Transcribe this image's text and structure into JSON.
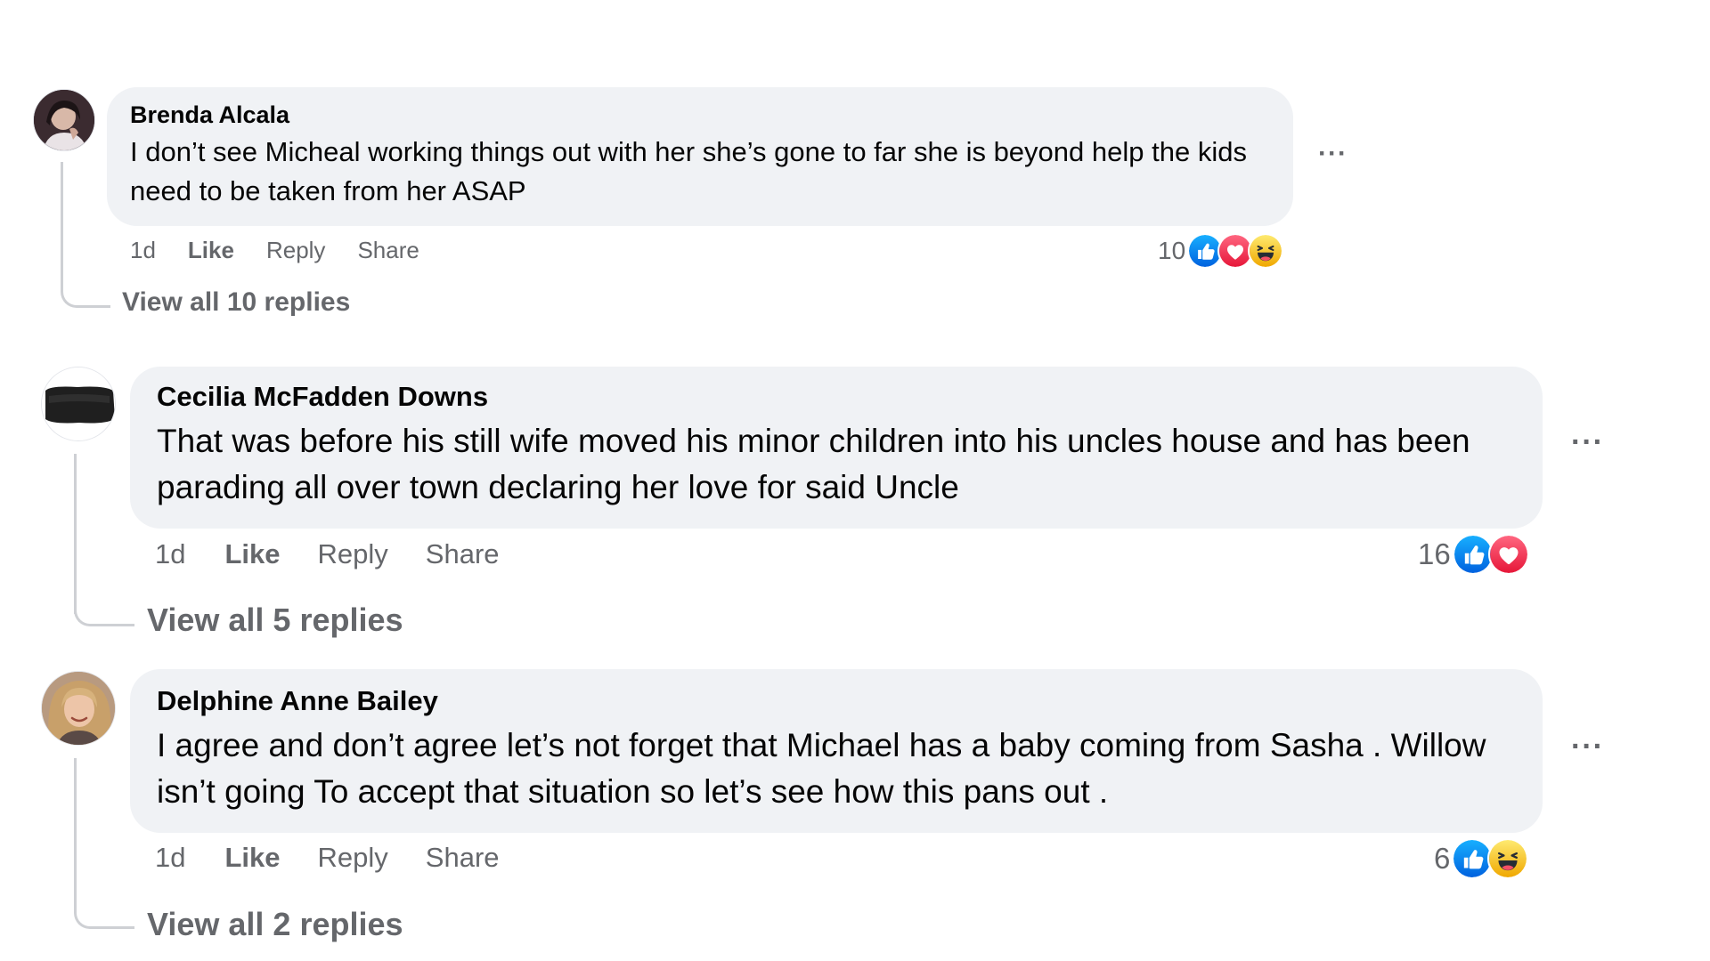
{
  "comments": [
    {
      "author": "Brenda Alcala",
      "text": "I don’t see Micheal working things out with her she’s gone to far she is beyond help the kids need to be taken from her ASAP",
      "time": "1d",
      "like_label": "Like",
      "reply_label": "Reply",
      "share_label": "Share",
      "reaction_count": "10",
      "reactions": [
        "like-icon",
        "love-icon",
        "haha-icon"
      ],
      "view_replies": "View all 10 replies",
      "more_label": "···"
    },
    {
      "author": "Cecilia McFadden Downs",
      "text": "That was before his still wife moved his minor children into his uncles house and has been parading all over town declaring her love for said Uncle",
      "time": "1d",
      "like_label": "Like",
      "reply_label": "Reply",
      "share_label": "Share",
      "reaction_count": "16",
      "reactions": [
        "like-icon",
        "love-icon"
      ],
      "view_replies": "View all 5 replies",
      "more_label": "···"
    },
    {
      "author": "Delphine Anne Bailey",
      "text": "I agree and don’t agree let’s not forget that Michael has a baby coming from Sasha . Willow isn’t going To accept that situation so let’s see how this pans out .",
      "time": "1d",
      "like_label": "Like",
      "reply_label": "Reply",
      "share_label": "Share",
      "reaction_count": "6",
      "reactions": [
        "like-icon",
        "haha-icon"
      ],
      "view_replies": "View all 2 replies",
      "more_label": "···"
    }
  ],
  "colors": {
    "bubble": "#f0f2f5",
    "meta_text": "#65676b",
    "like_blue": "#1877f2",
    "love_red": "#f33e58",
    "haha_yellow": "#f7b928",
    "thread_line": "#ced0d4"
  }
}
